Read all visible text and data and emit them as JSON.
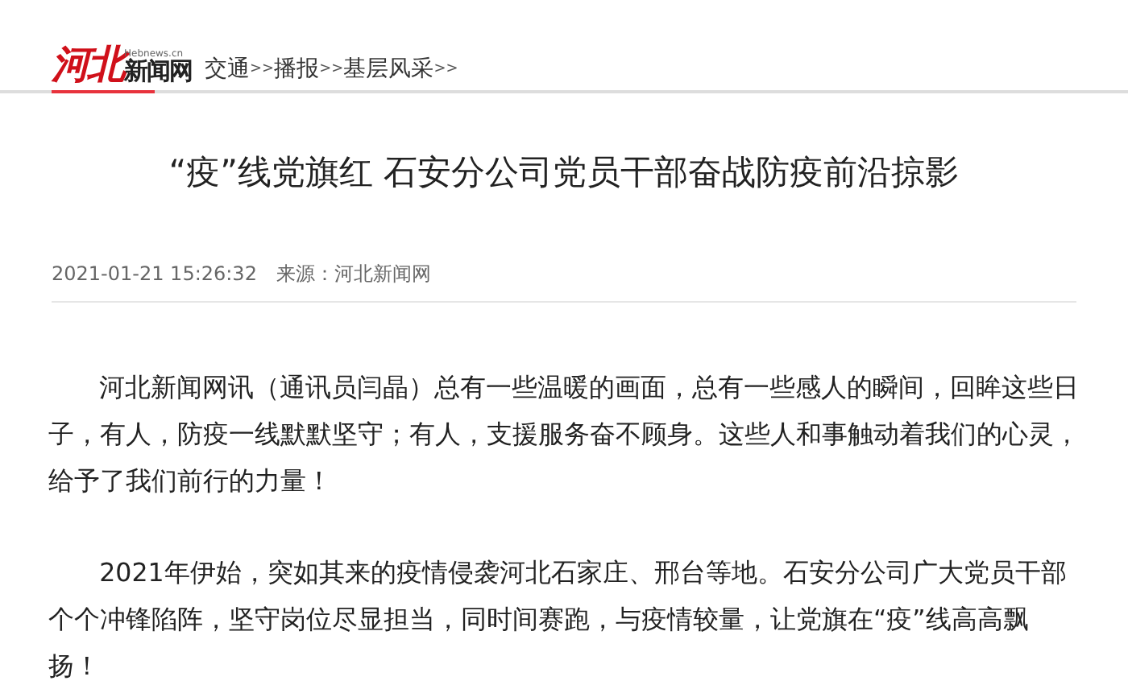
{
  "logo": {
    "mark": "河北",
    "domain": "Hebnews.cn",
    "name": "新闻网"
  },
  "breadcrumb": [
    {
      "label": "交通",
      "sep": ">>"
    },
    {
      "label": "播报",
      "sep": ">>"
    },
    {
      "label": "基层风采",
      "sep": ">>"
    }
  ],
  "article": {
    "title": "“疫”线党旗红 石安分公司党员干部奋战防疫前沿掠影",
    "datetime": "2021-01-21 15:26:32",
    "source": "来源：河北新闻网",
    "paragraphs": [
      "河北新闻网讯（通讯员闫晶）总有一些温暖的画面，总有一些感人的瞬间，回眸这些日子，有人，防疫一线默默坚守；有人，支援服务奋不顾身。这些人和事触动着我们的心灵，给予了我们前行的力量！",
      "2021年伊始，突如其来的疫情侵袭河北石家庄、邢台等地。石安分公司广大党员干部个个冲锋陷阵，坚守岗位尽显担当，同时间赛跑，与疫情较量，让党旗在“疫”线高高飘扬！"
    ]
  }
}
